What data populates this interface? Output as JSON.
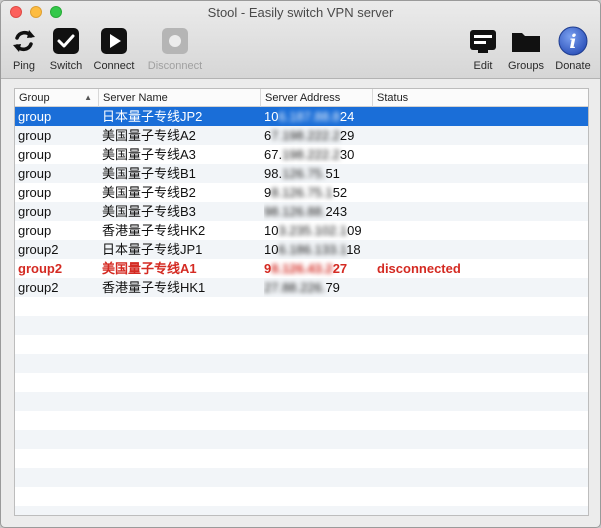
{
  "window": {
    "title": "Stool - Easily switch VPN server"
  },
  "toolbar": {
    "ping": "Ping",
    "switch": "Switch",
    "connect": "Connect",
    "disconnect": "Disconnect",
    "edit": "Edit",
    "groups": "Groups",
    "donate": "Donate"
  },
  "table": {
    "headers": {
      "group": "Group",
      "name": "Server Name",
      "address": "Server Address",
      "status": "Status"
    },
    "rows": [
      {
        "group": "group",
        "name": "日本量子专线JP2",
        "addr_a": "10",
        "addr_b": "6.187.88.8",
        "addr_c": "24",
        "status": ""
      },
      {
        "group": "group",
        "name": "美国量子专线A2",
        "addr_a": "6",
        "addr_b": "7.198.222.2",
        "addr_c": "29",
        "status": ""
      },
      {
        "group": "group",
        "name": "美国量子专线A3",
        "addr_a": "67.",
        "addr_b": "198.222.2",
        "addr_c": "30",
        "status": ""
      },
      {
        "group": "group",
        "name": "美国量子专线B1",
        "addr_a": "98.",
        "addr_b": "126.75.",
        "addr_c": "51",
        "status": ""
      },
      {
        "group": "group",
        "name": "美国量子专线B2",
        "addr_a": "9",
        "addr_b": "8.126.75.1",
        "addr_c": "52",
        "status": ""
      },
      {
        "group": "group",
        "name": "美国量子专线B3",
        "addr_a": "",
        "addr_b": "98.126.88.",
        "addr_c": "243",
        "status": ""
      },
      {
        "group": "group",
        "name": "香港量子专线HK2",
        "addr_a": "10",
        "addr_b": "3.235.102.1",
        "addr_c": "09",
        "status": ""
      },
      {
        "group": "group2",
        "name": "日本量子专线JP1",
        "addr_a": "10",
        "addr_b": "6.186.133.1",
        "addr_c": "18",
        "status": ""
      },
      {
        "group": "group2",
        "name": "美国量子专线A1",
        "addr_a": "9",
        "addr_b": "8.126.43.2",
        "addr_c": "27",
        "status": "disconnected"
      },
      {
        "group": "group2",
        "name": "香港量子专线HK1",
        "addr_a": "",
        "addr_b": "27.88.226.",
        "addr_c": "79",
        "status": ""
      }
    ]
  },
  "colors": {
    "selected": "#1a6ed8",
    "error": "#d42a22",
    "donate": "#3a63c9"
  },
  "icons": [
    "refresh-icon",
    "checkmark-icon",
    "play-icon",
    "stop-icon",
    "edit-icon",
    "folder-icon",
    "info-icon"
  ]
}
